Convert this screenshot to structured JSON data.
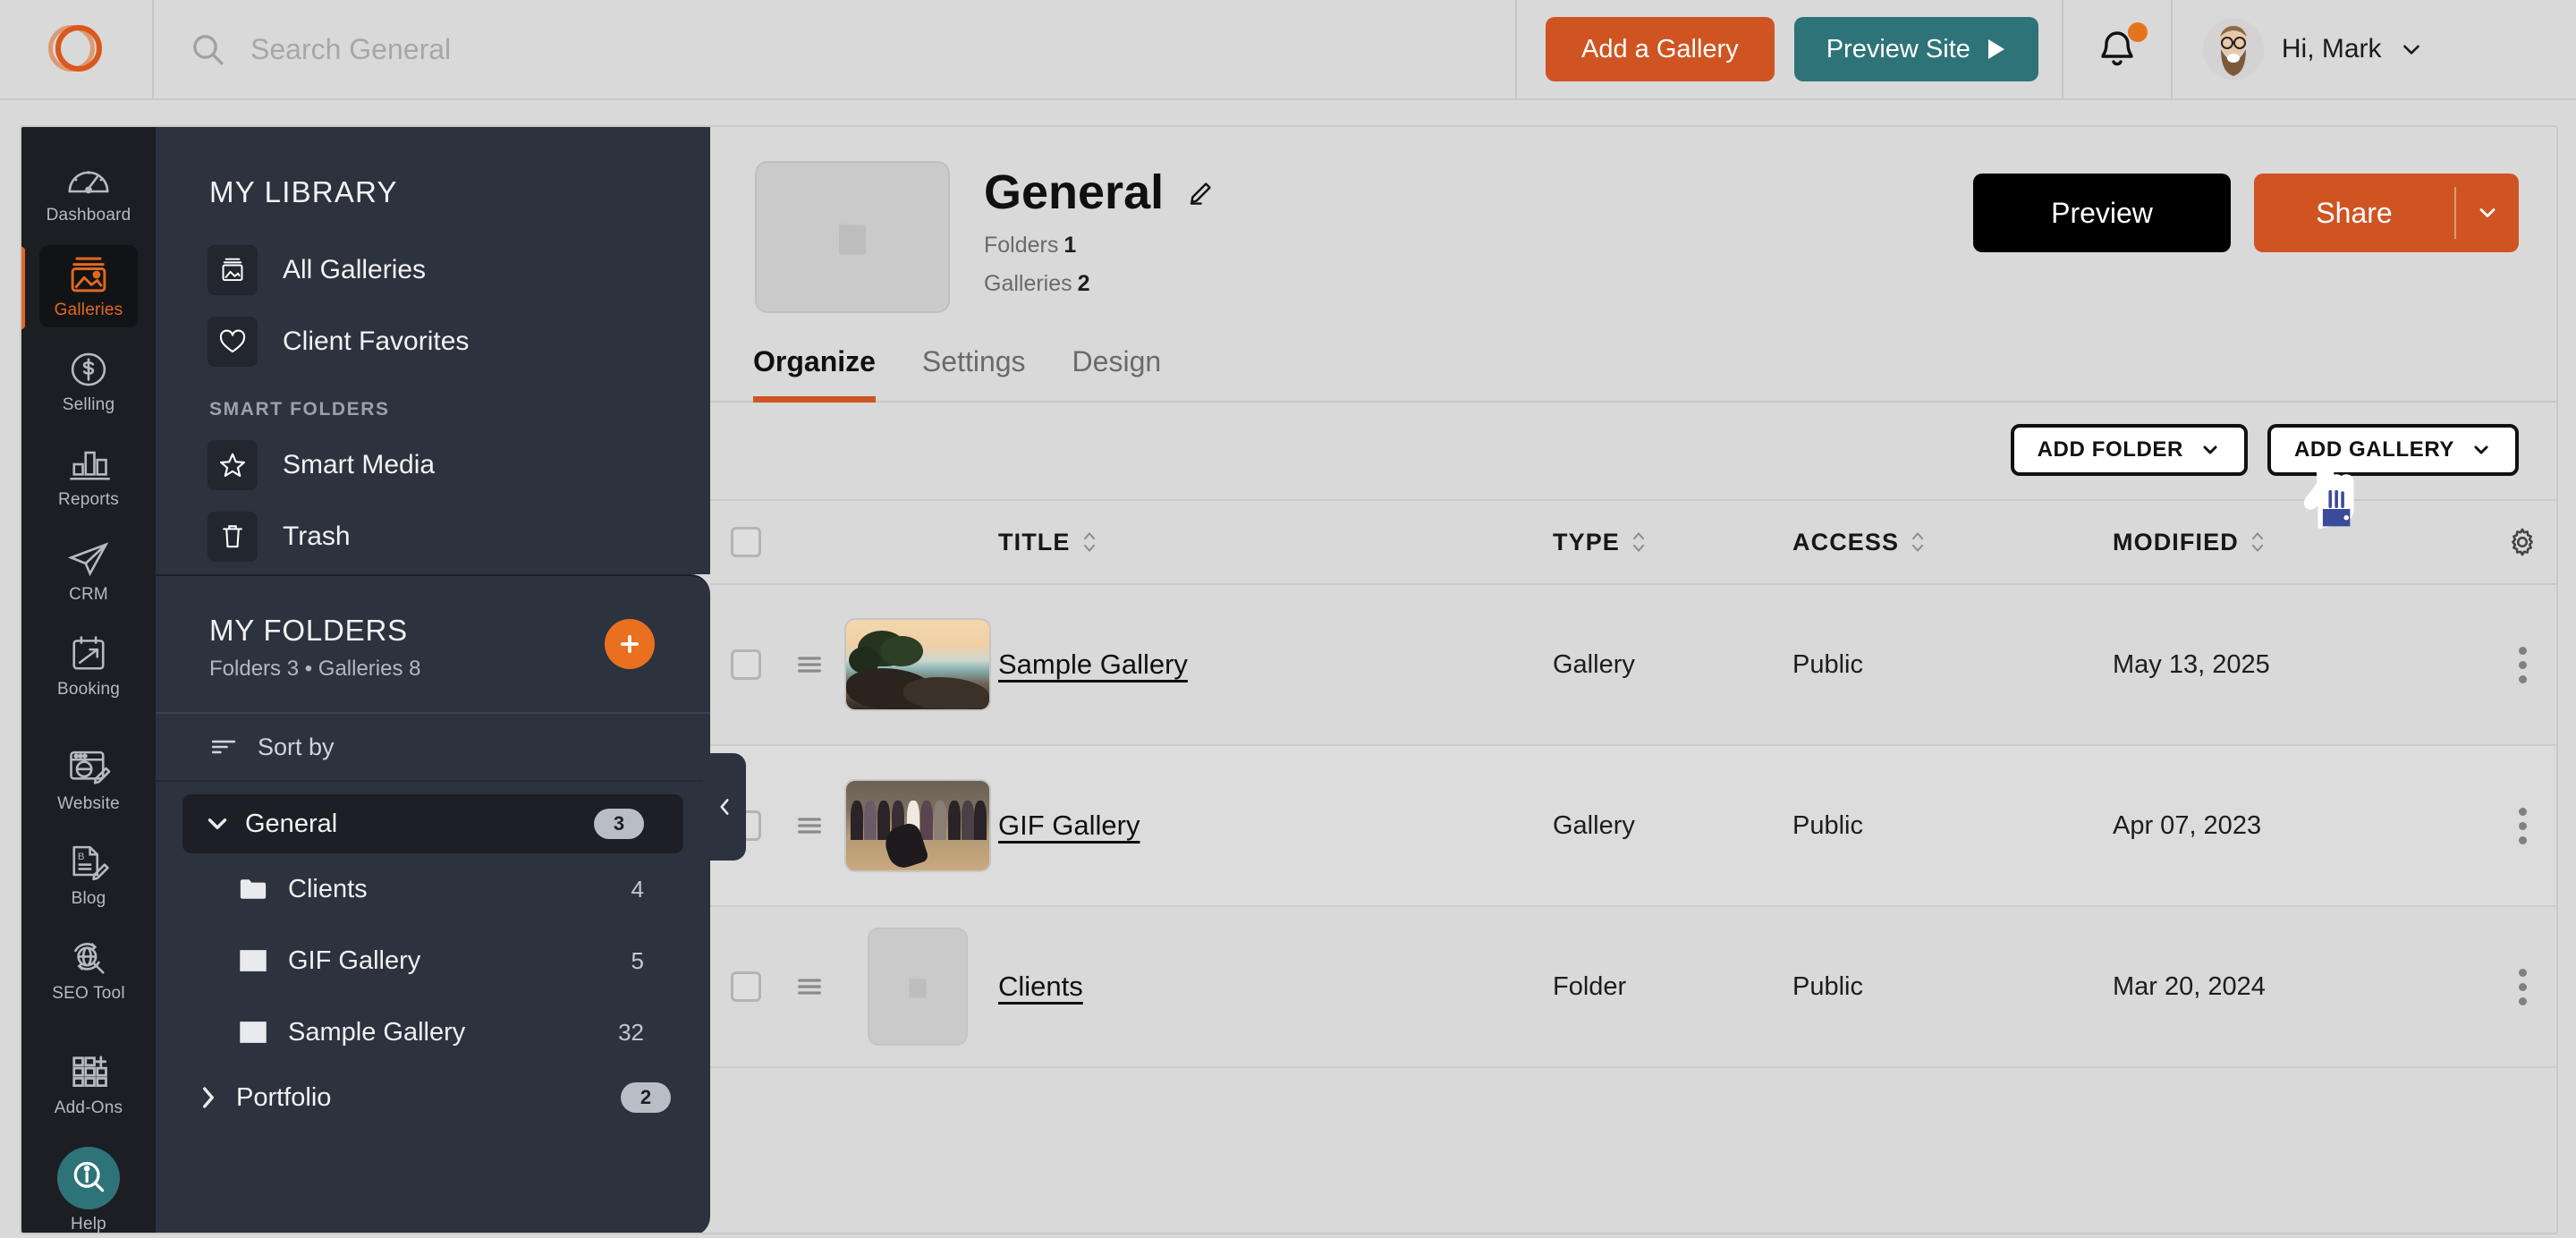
{
  "topbar": {
    "logo_name": "smugmug-logo",
    "search": {
      "placeholder": "Search General",
      "value": "",
      "icon": "search-icon"
    },
    "add_gallery_label": "Add a Gallery",
    "preview_site_label": "Preview Site",
    "notifications_icon": "bell-icon",
    "has_notification": true,
    "greeting": "Hi, Mark",
    "accent_orange": "#cf5422",
    "accent_teal": "#2e7378"
  },
  "rail": {
    "items": [
      {
        "label": "Dashboard",
        "icon": "gauge-icon",
        "active": false
      },
      {
        "label": "Galleries",
        "icon": "photo-stack-icon",
        "active": true
      },
      {
        "label": "Selling",
        "icon": "dollar-circle-icon",
        "active": false
      },
      {
        "label": "Reports",
        "icon": "bar-chart-icon",
        "active": false
      },
      {
        "label": "CRM",
        "icon": "paper-plane-icon",
        "active": false
      },
      {
        "label": "Booking",
        "icon": "calendar-arrow-icon",
        "active": false
      },
      {
        "label": "Website",
        "icon": "browser-pencil-icon",
        "active": false
      },
      {
        "label": "Blog",
        "icon": "document-pencil-icon",
        "active": false
      },
      {
        "label": "SEO Tool",
        "icon": "globe-search-icon",
        "active": false
      },
      {
        "label": "Add-Ons",
        "icon": "grid-plus-icon",
        "active": false
      },
      {
        "label": "Help",
        "icon": "info-search-icon",
        "active": false
      }
    ]
  },
  "library": {
    "title": "MY LIBRARY",
    "items": [
      {
        "label": "All Galleries",
        "icon": "gallery-icon"
      },
      {
        "label": "Client Favorites",
        "icon": "heart-icon"
      }
    ],
    "section_label": "SMART FOLDERS",
    "smart_items": [
      {
        "label": "Smart Media",
        "icon": "star-icon"
      },
      {
        "label": "Trash",
        "icon": "trash-icon"
      }
    ]
  },
  "folders": {
    "title": "MY FOLDERS",
    "subtitle": "Folders 3 • Galleries 8",
    "add_icon": "plus-icon",
    "collapse_icon": "chevron-left-icon",
    "sort_label": "Sort by",
    "sort_icon": "sort-icon",
    "tree": [
      {
        "name": "General",
        "badge": "3",
        "expanded": true,
        "selected": true,
        "children": [
          {
            "name": "Clients",
            "count": "4",
            "icon": "folder-icon"
          },
          {
            "name": "GIF Gallery",
            "count": "5",
            "icon": "image-icon"
          },
          {
            "name": "Sample Gallery",
            "count": "32",
            "icon": "image-icon"
          }
        ]
      },
      {
        "name": "Portfolio",
        "badge": "2",
        "expanded": false,
        "selected": false,
        "children": []
      }
    ]
  },
  "content": {
    "thumb_icon": "folder-icon",
    "title": "General",
    "edit_icon": "pencil-icon",
    "stats": [
      {
        "label": "Folders",
        "value": "1"
      },
      {
        "label": "Galleries",
        "value": "2"
      }
    ],
    "preview_label": "Preview",
    "share_label": "Share",
    "share_caret_icon": "chevron-down-icon",
    "tabs": [
      {
        "label": "Organize",
        "active": true
      },
      {
        "label": "Settings",
        "active": false
      },
      {
        "label": "Design",
        "active": false
      }
    ],
    "toolbar": {
      "add_folder_label": "ADD FOLDER",
      "add_gallery_label": "ADD GALLERY",
      "caret_icon": "chevron-down-icon"
    },
    "table": {
      "settings_icon": "gear-icon",
      "select_all_checked": false,
      "columns": [
        {
          "key": "title",
          "label": "TITLE",
          "sortable": true
        },
        {
          "key": "type",
          "label": "TYPE",
          "sortable": true
        },
        {
          "key": "access",
          "label": "ACCESS",
          "sortable": true
        },
        {
          "key": "modified",
          "label": "MODIFIED",
          "sortable": true
        }
      ],
      "rows": [
        {
          "title": "Sample Gallery",
          "type": "Gallery",
          "access": "Public",
          "modified": "May 13, 2025",
          "thumb": "beach",
          "checked": false
        },
        {
          "title": "GIF Gallery",
          "type": "Gallery",
          "access": "Public",
          "modified": "Apr 07, 2023",
          "thumb": "wedding",
          "checked": false
        },
        {
          "title": "Clients",
          "type": "Folder",
          "access": "Public",
          "modified": "Mar 20, 2024",
          "thumb": "folder",
          "checked": false
        }
      ]
    }
  },
  "cursor": {
    "icon": "pointing-hand-cursor",
    "color": "#3b4a9b"
  }
}
